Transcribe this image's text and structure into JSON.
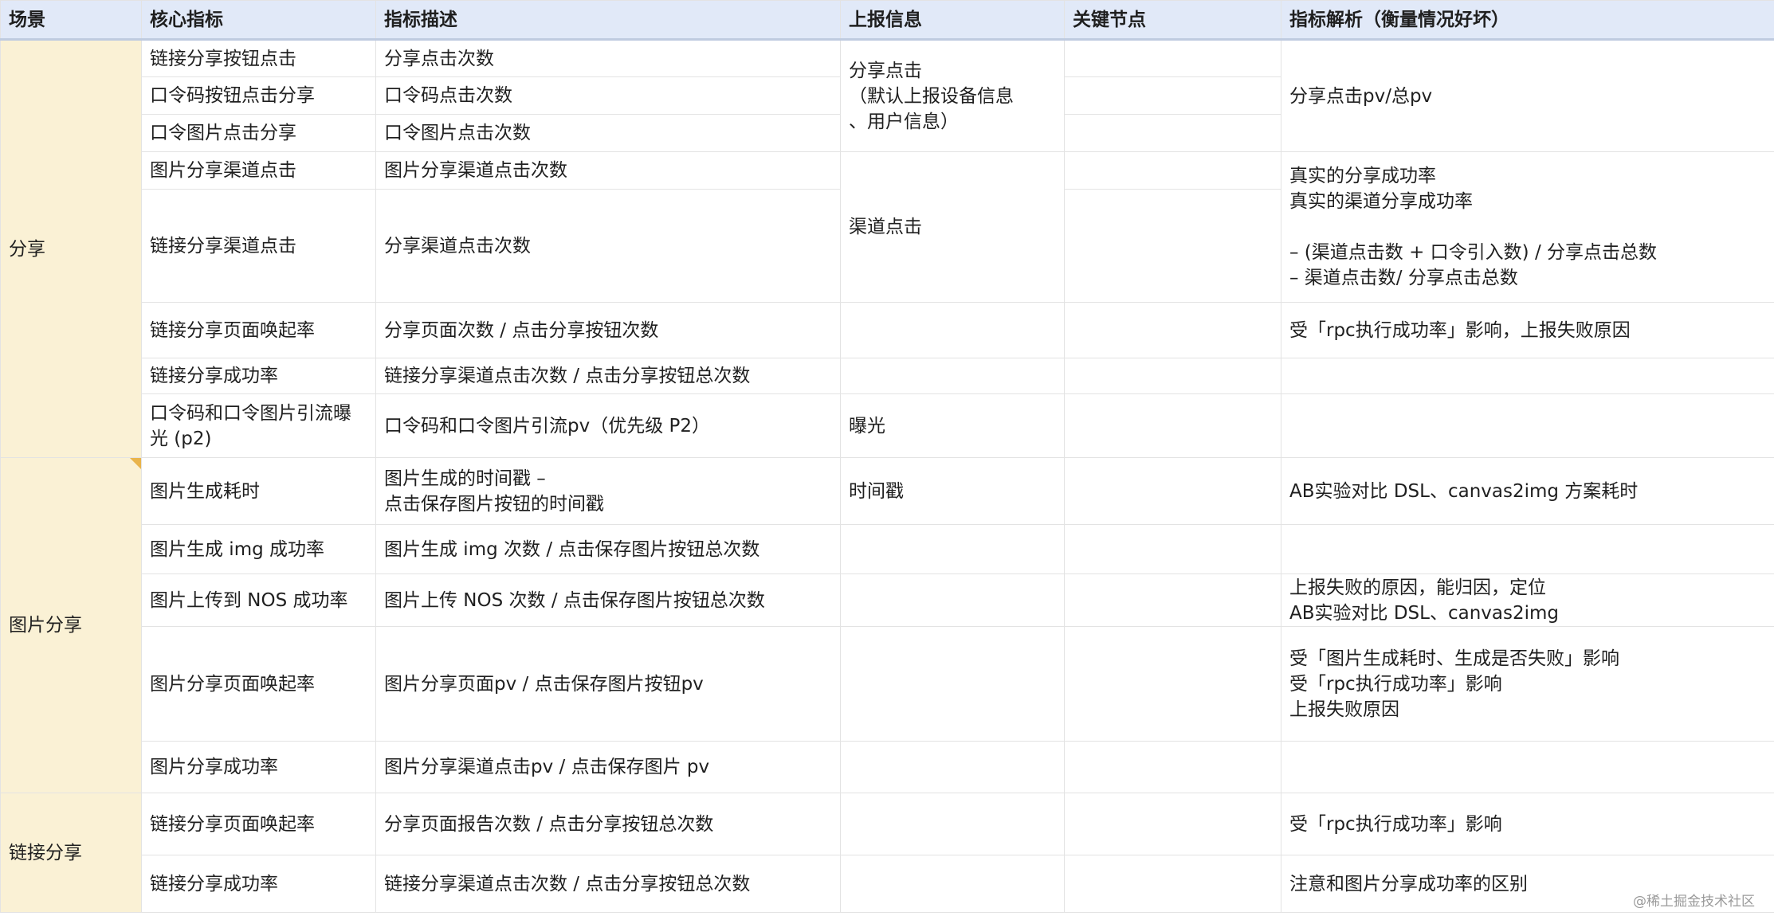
{
  "headers": [
    "场景",
    "核心指标",
    "指标描述",
    "上报信息",
    "关键节点",
    "指标解析（衡量情况好坏）"
  ],
  "scenes": {
    "share": "分享",
    "image_share": "图片分享",
    "link_share": "链接分享"
  },
  "rows": [
    {
      "metric": "链接分享按钮点击",
      "desc": "分享点击次数",
      "key": "",
      "analysis": ""
    },
    {
      "metric": "口令码按钮点击分享",
      "desc": "口令码点击次数",
      "key": ""
    },
    {
      "metric": "口令图片点击分享",
      "desc": "口令图片点击次数",
      "key": ""
    },
    {
      "metric": "图片分享渠道点击",
      "desc": "图片分享渠道点击次数",
      "key": ""
    },
    {
      "metric": "链接分享渠道点击",
      "desc": "分享渠道点击次数",
      "key": ""
    },
    {
      "metric": "链接分享页面唤起率",
      "desc": "分享页面次数 / 点击分享按钮次数",
      "report": "",
      "key": "",
      "analysis": "受「rpc执行成功率」影响，上报失败原因"
    },
    {
      "metric": "链接分享成功率",
      "desc": "链接分享渠道点击次数 / 点击分享按钮总次数",
      "report": "",
      "key": "",
      "analysis": ""
    },
    {
      "metric": "口令码和口令图片引流曝光 (p2)",
      "desc": "口令码和口令图片引流pv（优先级 P2）",
      "report": "曝光",
      "key": "",
      "analysis": ""
    },
    {
      "metric": "图片生成耗时",
      "desc": "图片生成的时间戳 –\n点击保存图片按钮的时间戳",
      "report": "时间戳",
      "key": "",
      "analysis": "AB实验对比 DSL、canvas2img 方案耗时"
    },
    {
      "metric": "图片生成 img  成功率",
      "desc": "图片生成 img 次数 / 点击保存图片按钮总次数",
      "report": "",
      "key": "",
      "analysis": ""
    },
    {
      "metric": "图片上传到 NOS 成功率",
      "desc": "图片上传 NOS 次数 / 点击保存图片按钮总次数",
      "report": "",
      "key": "",
      "analysis": "上报失败的原因，能归因，定位\nAB实验对比 DSL、canvas2img"
    },
    {
      "metric": "图片分享页面唤起率",
      "desc": "图片分享页面pv / 点击保存图片按钮pv",
      "report": "",
      "key": "",
      "analysis": "受「图片生成耗时、生成是否失败」影响\n受「rpc执行成功率」影响\n上报失败原因"
    },
    {
      "metric": "图片分享成功率",
      "desc": "图片分享渠道点击pv / 点击保存图片 pv",
      "report": "",
      "key": "",
      "analysis": ""
    },
    {
      "metric": "链接分享页面唤起率",
      "desc": "分享页面报告次数 / 点击分享按钮总次数",
      "report": "",
      "key": "",
      "analysis": "受「rpc执行成功率」影响"
    },
    {
      "metric": "链接分享成功率",
      "desc": "链接分享渠道点击次数 / 点击分享按钮总次数",
      "report": "",
      "key": "",
      "analysis": "注意和图片分享成功率的区别"
    }
  ],
  "merged": {
    "report_share_click": "分享点击\n（默认上报设备信息\n、用户信息）",
    "report_channel_click": "渠道点击",
    "analysis_share_click": "分享点击pv/总pv",
    "analysis_channel": "真实的分享成功率\n真实的渠道分享成功率\n\n– (渠道点击数 + 口令引入数) / 分享点击总数\n– 渠道点击数/ 分享点击总数"
  },
  "footer": {
    "watermark": "@稀土掘金技术社区"
  }
}
